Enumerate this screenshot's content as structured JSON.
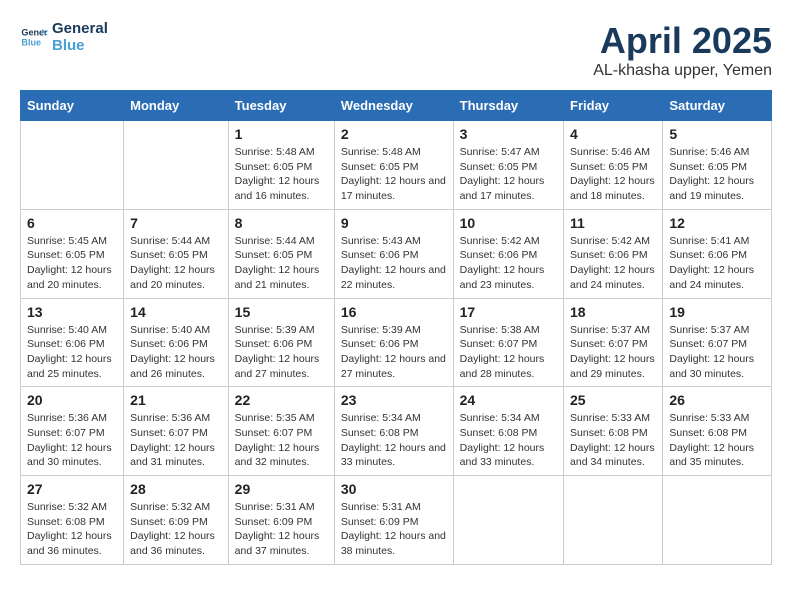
{
  "header": {
    "logo_line1": "General",
    "logo_line2": "Blue",
    "title": "April 2025",
    "subtitle": "AL-khasha upper, Yemen"
  },
  "days_of_week": [
    "Sunday",
    "Monday",
    "Tuesday",
    "Wednesday",
    "Thursday",
    "Friday",
    "Saturday"
  ],
  "weeks": [
    [
      {
        "day": "",
        "info": ""
      },
      {
        "day": "",
        "info": ""
      },
      {
        "day": "1",
        "info": "Sunrise: 5:48 AM\nSunset: 6:05 PM\nDaylight: 12 hours and 16 minutes."
      },
      {
        "day": "2",
        "info": "Sunrise: 5:48 AM\nSunset: 6:05 PM\nDaylight: 12 hours and 17 minutes."
      },
      {
        "day": "3",
        "info": "Sunrise: 5:47 AM\nSunset: 6:05 PM\nDaylight: 12 hours and 17 minutes."
      },
      {
        "day": "4",
        "info": "Sunrise: 5:46 AM\nSunset: 6:05 PM\nDaylight: 12 hours and 18 minutes."
      },
      {
        "day": "5",
        "info": "Sunrise: 5:46 AM\nSunset: 6:05 PM\nDaylight: 12 hours and 19 minutes."
      }
    ],
    [
      {
        "day": "6",
        "info": "Sunrise: 5:45 AM\nSunset: 6:05 PM\nDaylight: 12 hours and 20 minutes."
      },
      {
        "day": "7",
        "info": "Sunrise: 5:44 AM\nSunset: 6:05 PM\nDaylight: 12 hours and 20 minutes."
      },
      {
        "day": "8",
        "info": "Sunrise: 5:44 AM\nSunset: 6:05 PM\nDaylight: 12 hours and 21 minutes."
      },
      {
        "day": "9",
        "info": "Sunrise: 5:43 AM\nSunset: 6:06 PM\nDaylight: 12 hours and 22 minutes."
      },
      {
        "day": "10",
        "info": "Sunrise: 5:42 AM\nSunset: 6:06 PM\nDaylight: 12 hours and 23 minutes."
      },
      {
        "day": "11",
        "info": "Sunrise: 5:42 AM\nSunset: 6:06 PM\nDaylight: 12 hours and 24 minutes."
      },
      {
        "day": "12",
        "info": "Sunrise: 5:41 AM\nSunset: 6:06 PM\nDaylight: 12 hours and 24 minutes."
      }
    ],
    [
      {
        "day": "13",
        "info": "Sunrise: 5:40 AM\nSunset: 6:06 PM\nDaylight: 12 hours and 25 minutes."
      },
      {
        "day": "14",
        "info": "Sunrise: 5:40 AM\nSunset: 6:06 PM\nDaylight: 12 hours and 26 minutes."
      },
      {
        "day": "15",
        "info": "Sunrise: 5:39 AM\nSunset: 6:06 PM\nDaylight: 12 hours and 27 minutes."
      },
      {
        "day": "16",
        "info": "Sunrise: 5:39 AM\nSunset: 6:06 PM\nDaylight: 12 hours and 27 minutes."
      },
      {
        "day": "17",
        "info": "Sunrise: 5:38 AM\nSunset: 6:07 PM\nDaylight: 12 hours and 28 minutes."
      },
      {
        "day": "18",
        "info": "Sunrise: 5:37 AM\nSunset: 6:07 PM\nDaylight: 12 hours and 29 minutes."
      },
      {
        "day": "19",
        "info": "Sunrise: 5:37 AM\nSunset: 6:07 PM\nDaylight: 12 hours and 30 minutes."
      }
    ],
    [
      {
        "day": "20",
        "info": "Sunrise: 5:36 AM\nSunset: 6:07 PM\nDaylight: 12 hours and 30 minutes."
      },
      {
        "day": "21",
        "info": "Sunrise: 5:36 AM\nSunset: 6:07 PM\nDaylight: 12 hours and 31 minutes."
      },
      {
        "day": "22",
        "info": "Sunrise: 5:35 AM\nSunset: 6:07 PM\nDaylight: 12 hours and 32 minutes."
      },
      {
        "day": "23",
        "info": "Sunrise: 5:34 AM\nSunset: 6:08 PM\nDaylight: 12 hours and 33 minutes."
      },
      {
        "day": "24",
        "info": "Sunrise: 5:34 AM\nSunset: 6:08 PM\nDaylight: 12 hours and 33 minutes."
      },
      {
        "day": "25",
        "info": "Sunrise: 5:33 AM\nSunset: 6:08 PM\nDaylight: 12 hours and 34 minutes."
      },
      {
        "day": "26",
        "info": "Sunrise: 5:33 AM\nSunset: 6:08 PM\nDaylight: 12 hours and 35 minutes."
      }
    ],
    [
      {
        "day": "27",
        "info": "Sunrise: 5:32 AM\nSunset: 6:08 PM\nDaylight: 12 hours and 36 minutes."
      },
      {
        "day": "28",
        "info": "Sunrise: 5:32 AM\nSunset: 6:09 PM\nDaylight: 12 hours and 36 minutes."
      },
      {
        "day": "29",
        "info": "Sunrise: 5:31 AM\nSunset: 6:09 PM\nDaylight: 12 hours and 37 minutes."
      },
      {
        "day": "30",
        "info": "Sunrise: 5:31 AM\nSunset: 6:09 PM\nDaylight: 12 hours and 38 minutes."
      },
      {
        "day": "",
        "info": ""
      },
      {
        "day": "",
        "info": ""
      },
      {
        "day": "",
        "info": ""
      }
    ]
  ]
}
